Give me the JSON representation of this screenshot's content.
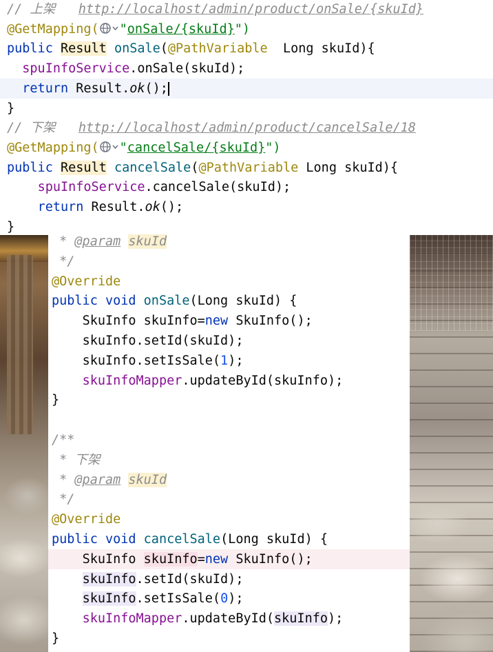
{
  "top_editor": {
    "lines": [
      {
        "indent": "",
        "tokens": [
          {
            "t": "// 上架   ",
            "c": "c-comment"
          },
          {
            "t": "http://localhost/admin/product/onSale/",
            "c": "c-url"
          },
          {
            "t": "{skuId}",
            "c": "c-url"
          }
        ]
      },
      {
        "indent": "",
        "tokens": [
          {
            "t": "@GetMapping(",
            "c": "c-ann"
          },
          {
            "t": "GLOBE"
          },
          {
            "t": "\"",
            "c": "c-str"
          },
          {
            "t": "onSale/{skuId}",
            "c": "c-strlink"
          },
          {
            "t": "\")",
            "c": "c-str"
          }
        ]
      },
      {
        "indent": "",
        "tokens": [
          {
            "t": "public ",
            "c": "c-kw"
          },
          {
            "t": "Result",
            "c": "hl-yellow"
          },
          {
            "t": " "
          },
          {
            "t": "onSale",
            "c": "c-method"
          },
          {
            "t": "("
          },
          {
            "t": "@PathVariable",
            "c": "c-ann"
          },
          {
            "t": "  Long skuId){"
          }
        ]
      },
      {
        "indent": "  ",
        "tokens": [
          {
            "t": "spuInfoService",
            "c": "c-field"
          },
          {
            "t": ".onSale(skuId);"
          }
        ]
      },
      {
        "indent": "  ",
        "current": true,
        "tokens": [
          {
            "t": "return ",
            "c": "c-kw"
          },
          {
            "t": "Result."
          },
          {
            "t": "ok",
            "c": "c-italic"
          },
          {
            "t": "();"
          },
          {
            "t": "CURSOR"
          }
        ]
      },
      {
        "indent": "",
        "tokens": [
          {
            "t": "}"
          }
        ]
      },
      {
        "indent": "",
        "tokens": [
          {
            "t": "// 下架   ",
            "c": "c-comment"
          },
          {
            "t": "http://localhost/admin/product/cancelSale/18",
            "c": "c-url"
          }
        ]
      },
      {
        "indent": "",
        "tokens": [
          {
            "t": "@GetMapping(",
            "c": "c-ann"
          },
          {
            "t": "GLOBE"
          },
          {
            "t": "\"",
            "c": "c-str"
          },
          {
            "t": "cancelSale/{skuId}",
            "c": "c-strlink"
          },
          {
            "t": "\")",
            "c": "c-str"
          }
        ]
      },
      {
        "indent": "",
        "tokens": [
          {
            "t": "public ",
            "c": "c-kw"
          },
          {
            "t": "Result",
            "c": "hl-yellow"
          },
          {
            "t": " "
          },
          {
            "t": "cancelSale",
            "c": "c-method"
          },
          {
            "t": "("
          },
          {
            "t": "@PathVariable",
            "c": "c-ann"
          },
          {
            "t": " Long skuId){"
          }
        ]
      },
      {
        "indent": "    ",
        "tokens": [
          {
            "t": "spuInfoService",
            "c": "c-field"
          },
          {
            "t": ".cancelSale(skuId);"
          }
        ]
      },
      {
        "indent": "    ",
        "tokens": [
          {
            "t": "return ",
            "c": "c-kw"
          },
          {
            "t": "Result."
          },
          {
            "t": "ok",
            "c": "c-italic"
          },
          {
            "t": "();"
          }
        ]
      },
      {
        "indent": "",
        "tokens": [
          {
            "t": "}"
          }
        ]
      }
    ]
  },
  "bottom_editor": {
    "lines": [
      {
        "indent": " ",
        "tokens": [
          {
            "t": "* ",
            "c": "c-comment"
          },
          {
            "t": "@param",
            "c": "c-tag"
          },
          {
            "t": " "
          },
          {
            "t": "skuId",
            "c": "c-comment hl-yellow"
          }
        ]
      },
      {
        "indent": " ",
        "tokens": [
          {
            "t": "*/",
            "c": "c-comment"
          }
        ]
      },
      {
        "indent": "",
        "tokens": [
          {
            "t": "@Override",
            "c": "c-ann"
          }
        ]
      },
      {
        "indent": "",
        "tokens": [
          {
            "t": "public ",
            "c": "c-kw"
          },
          {
            "t": "void ",
            "c": "c-kw"
          },
          {
            "t": "onSale",
            "c": "c-method"
          },
          {
            "t": "(Long skuId) {"
          }
        ]
      },
      {
        "indent": "    ",
        "tokens": [
          {
            "t": "SkuInfo skuInfo="
          },
          {
            "t": "new ",
            "c": "c-kw"
          },
          {
            "t": "SkuInfo();"
          }
        ]
      },
      {
        "indent": "    ",
        "tokens": [
          {
            "t": "skuInfo.setId(skuId);"
          }
        ]
      },
      {
        "indent": "    ",
        "tokens": [
          {
            "t": "skuInfo.setIsSale("
          },
          {
            "t": "1",
            "c": "c-num"
          },
          {
            "t": ");"
          }
        ]
      },
      {
        "indent": "    ",
        "tokens": [
          {
            "t": "skuInfoMapper",
            "c": "c-field"
          },
          {
            "t": ".updateById(skuInfo);"
          }
        ]
      },
      {
        "indent": "",
        "tokens": [
          {
            "t": "}"
          }
        ]
      },
      {
        "indent": "",
        "tokens": [
          {
            "t": ""
          }
        ]
      },
      {
        "indent": "",
        "tokens": [
          {
            "t": "/**",
            "c": "c-comment"
          }
        ]
      },
      {
        "indent": " ",
        "tokens": [
          {
            "t": "* 下架",
            "c": "c-comment"
          }
        ]
      },
      {
        "indent": " ",
        "tokens": [
          {
            "t": "* ",
            "c": "c-comment"
          },
          {
            "t": "@param",
            "c": "c-tag"
          },
          {
            "t": " "
          },
          {
            "t": "skuId",
            "c": "c-comment hl-yellow"
          }
        ]
      },
      {
        "indent": " ",
        "tokens": [
          {
            "t": "*/",
            "c": "c-comment"
          }
        ]
      },
      {
        "indent": "",
        "tokens": [
          {
            "t": "@Override",
            "c": "c-ann"
          }
        ]
      },
      {
        "indent": "",
        "tokens": [
          {
            "t": "public ",
            "c": "c-kw"
          },
          {
            "t": "void ",
            "c": "c-kw"
          },
          {
            "t": "cancelSale",
            "c": "c-method"
          },
          {
            "t": "(Long skuId) {"
          }
        ]
      },
      {
        "indent": "    ",
        "current": true,
        "tokens": [
          {
            "t": "SkuInfo "
          },
          {
            "t": "skuInfo",
            "c": "hl-pink"
          },
          {
            "t": "="
          },
          {
            "t": "new ",
            "c": "c-kw"
          },
          {
            "t": "SkuInfo();"
          }
        ]
      },
      {
        "indent": "    ",
        "tokens": [
          {
            "t": "skuInfo",
            "c": "hl-purple"
          },
          {
            "t": ".setId(skuId);"
          }
        ]
      },
      {
        "indent": "    ",
        "tokens": [
          {
            "t": "skuInfo",
            "c": "hl-purple"
          },
          {
            "t": ".setIsSale("
          },
          {
            "t": "0",
            "c": "c-num"
          },
          {
            "t": ");"
          }
        ]
      },
      {
        "indent": "    ",
        "tokens": [
          {
            "t": "skuInfoMapper",
            "c": "c-field"
          },
          {
            "t": ".updateById("
          },
          {
            "t": "skuInfo",
            "c": "hl-purple"
          },
          {
            "t": ");"
          }
        ]
      },
      {
        "indent": "",
        "tokens": [
          {
            "t": "}"
          }
        ]
      }
    ]
  }
}
